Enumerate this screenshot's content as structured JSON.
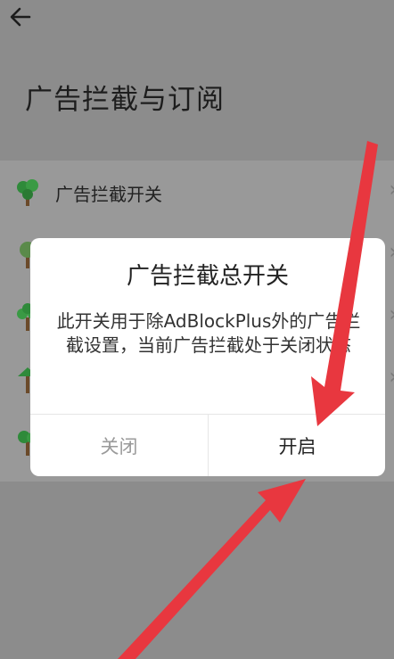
{
  "header": {
    "title": "广告拦截与订阅"
  },
  "list": {
    "items": [
      {
        "label": "广告拦截开关"
      }
    ]
  },
  "dialog": {
    "title": "广告拦截总开关",
    "message": "此开关用于除AdBlockPlus外的广告拦截设置，当前广告拦截处于关闭状态",
    "cancel_label": "关闭",
    "confirm_label": "开启"
  },
  "colors": {
    "overlay": "#8c8c8c",
    "annotation_arrow": "#e8373f",
    "icon_green": "#2f8a3a"
  },
  "icons": [
    "back-arrow-icon",
    "tree-icon",
    "chevron-right-icon"
  ]
}
